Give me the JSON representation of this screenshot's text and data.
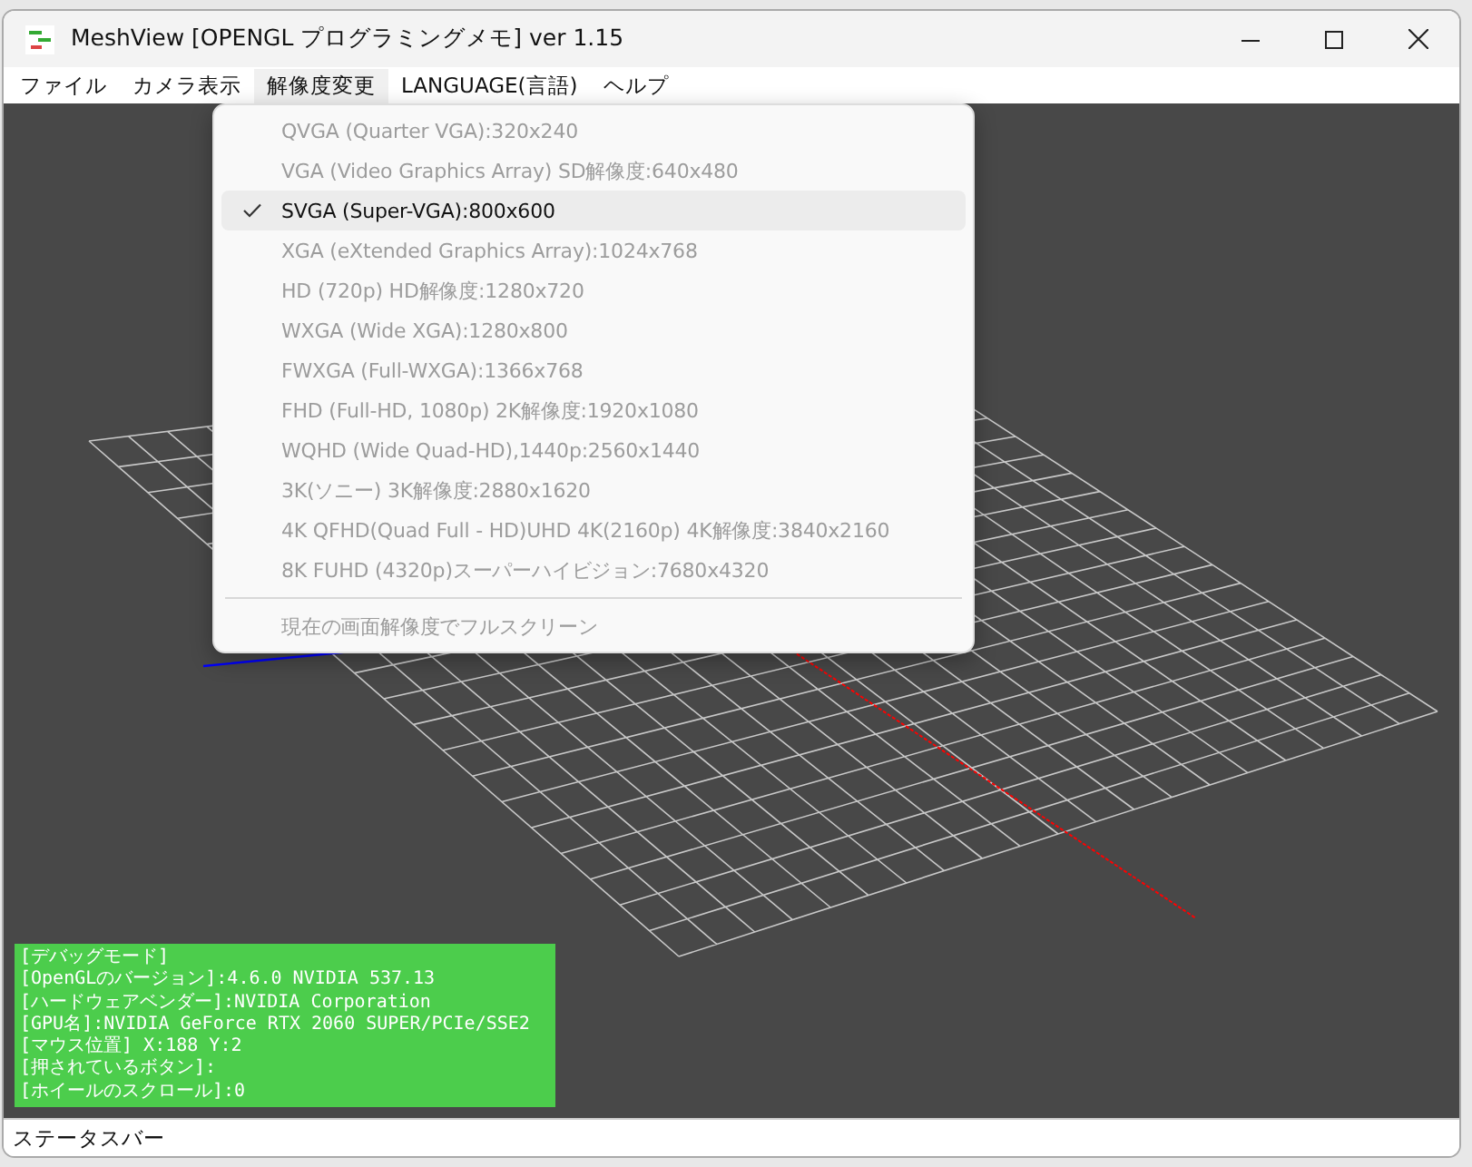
{
  "window": {
    "title": "MeshView [OPENGL プログラミングメモ] ver 1.15"
  },
  "menu_bar": [
    {
      "label": "ファイル",
      "selected": false
    },
    {
      "label": "カメラ表示",
      "selected": false
    },
    {
      "label": "解像度変更",
      "selected": true
    },
    {
      "label": "LANGUAGE(言語)",
      "selected": false
    },
    {
      "label": "ヘルプ",
      "selected": false
    }
  ],
  "dropdown": {
    "items": [
      {
        "kind": "item",
        "label": "QVGA (Quarter VGA):320x240",
        "checked": false,
        "disabled": true,
        "selected": false
      },
      {
        "kind": "item",
        "label": "VGA (Video Graphics Array) SD解像度:640x480",
        "checked": false,
        "disabled": true,
        "selected": false
      },
      {
        "kind": "item",
        "label": "SVGA (Super-VGA):800x600",
        "checked": true,
        "disabled": false,
        "selected": true
      },
      {
        "kind": "item",
        "label": "XGA (eXtended Graphics Array):1024x768",
        "checked": false,
        "disabled": true,
        "selected": false
      },
      {
        "kind": "item",
        "label": "HD (720p) HD解像度:1280x720",
        "checked": false,
        "disabled": true,
        "selected": false
      },
      {
        "kind": "item",
        "label": "WXGA (Wide XGA):1280x800",
        "checked": false,
        "disabled": true,
        "selected": false
      },
      {
        "kind": "item",
        "label": "FWXGA (Full-WXGA):1366x768",
        "checked": false,
        "disabled": true,
        "selected": false
      },
      {
        "kind": "item",
        "label": "FHD (Full-HD, 1080p) 2K解像度:1920x1080",
        "checked": false,
        "disabled": true,
        "selected": false
      },
      {
        "kind": "item",
        "label": "WQHD (Wide Quad-HD),1440p:2560x1440",
        "checked": false,
        "disabled": true,
        "selected": false
      },
      {
        "kind": "item",
        "label": "3K(ソニー) 3K解像度:2880x1620",
        "checked": false,
        "disabled": true,
        "selected": false
      },
      {
        "kind": "item",
        "label": "4K QFHD(Quad Full - HD)UHD 4K(2160p) 4K解像度:3840x2160",
        "checked": false,
        "disabled": true,
        "selected": false
      },
      {
        "kind": "item",
        "label": "8K FUHD (4320p)スーパーハイビジョン:7680x4320",
        "checked": false,
        "disabled": true,
        "selected": false
      },
      {
        "kind": "separator"
      },
      {
        "kind": "item",
        "label": "現在の画面解像度でフルスクリーン",
        "checked": false,
        "disabled": true,
        "selected": false
      }
    ]
  },
  "debug_panel": {
    "lines": [
      "[デバッグモード]",
      "[OpenGLのバージョン]:4.6.0 NVIDIA 537.13",
      "[ハードウェアベンダー]:NVIDIA Corporation",
      "[GPU名]:NVIDIA GeForce RTX 2060 SUPER/PCIe/SSE2",
      "[マウス位置] X:188 Y:2",
      "[押されているボタン]:",
      "[ホイールのスクロール]:0"
    ]
  },
  "status_bar": {
    "text": "ステータスバー"
  }
}
